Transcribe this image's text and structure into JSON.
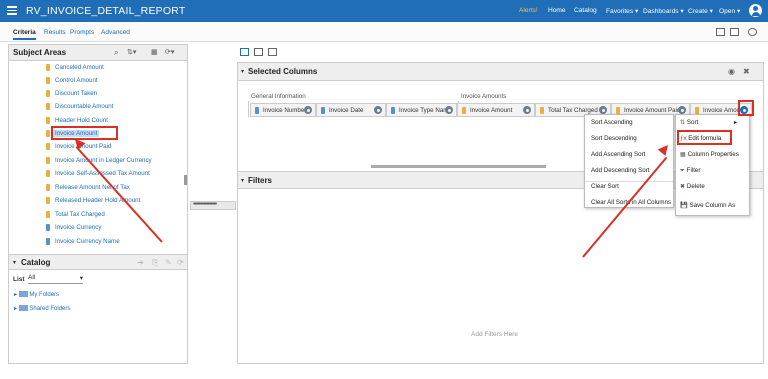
{
  "header": {
    "app_title": "RV_INVOICE_DETAIL_REPORT",
    "nav": [
      "Alerts!",
      "Home",
      "Catalog",
      "Favorites ▾",
      "Dashboards ▾",
      "Create ▾",
      "Open ▾"
    ]
  },
  "tabs": [
    "Criteria",
    "Results",
    "Prompts",
    "Advanced"
  ],
  "subject_areas": {
    "title": "Subject Areas",
    "items": [
      "Canceled Amount",
      "Control Amount",
      "Discount Taken",
      "Discountable Amount",
      "Header Hold Count",
      "Invoice Amount",
      "Invoice Amount Paid",
      "Invoice Amount in Ledger Currency",
      "Invoice Self-Assessed Tax Amount",
      "Release Amount Net of Tax",
      "Released Header Hold Amount",
      "Total Tax Charged",
      "Invoice Currency",
      "Invoice Currency Name"
    ]
  },
  "catalog": {
    "title": "Catalog",
    "list_label": "List",
    "list_value": "All",
    "folders": [
      "My Folders",
      "Shared Folders"
    ]
  },
  "selected_columns": {
    "title": "Selected Columns",
    "groups": [
      "General Information",
      "Invoice Amounts"
    ],
    "columns": [
      "Invoice Number",
      "Invoice Date",
      "Invoice Type Name",
      "Invoice Amount",
      "Total Tax Charged",
      "Invoice Amount Paid",
      "Invoice Amoun"
    ]
  },
  "filters": {
    "title": "Filters",
    "placeholder": "Add Filters Here"
  },
  "sort_menu": [
    "Sort Ascending",
    "Sort Descending",
    "Add Ascending Sort",
    "Add Descending Sort",
    "Clear Sort",
    "Clear All Sorts in All Columns"
  ],
  "column_menu": [
    "Sort",
    "Edit formula",
    "Column Properties",
    "Filter",
    "Delete",
    "Save Column As"
  ],
  "colors": {
    "accent": "#1f6eb7",
    "highlight": "#d93025"
  }
}
